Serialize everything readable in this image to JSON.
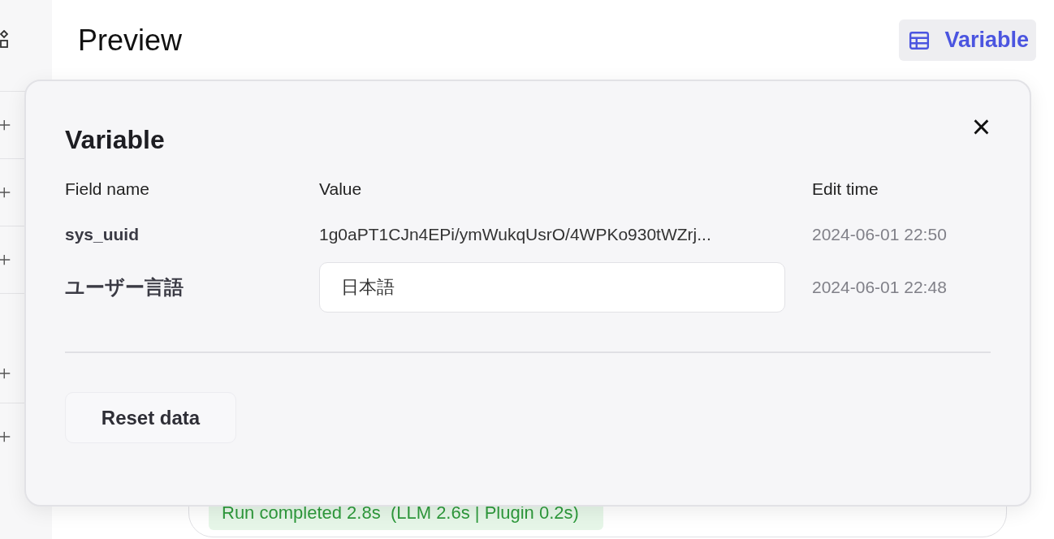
{
  "header": {
    "title": "Preview",
    "variable_button": "Variable"
  },
  "sidebar": {
    "items": [
      {
        "kind": "add"
      },
      {
        "kind": "add"
      },
      {
        "kind": "add"
      },
      {
        "kind": "add"
      },
      {
        "kind": "add"
      }
    ]
  },
  "run_status": "Run completed 2.8s  (LLM 2.6s | Plugin 0.2s)",
  "dialog": {
    "title": "Variable",
    "close": "×",
    "columns": [
      "Field name",
      "Value",
      "Edit time"
    ],
    "rows": [
      {
        "kind": "text",
        "name": "sys_uuid",
        "value": "1g0aPT1CJn4EPi/ymWukqUsrO/4WPKo930tWZrj...",
        "time": "2024-06-01 22:50"
      },
      {
        "kind": "input",
        "name": "ユーザー言語",
        "value": "日本語",
        "time": "2024-06-01 22:48"
      }
    ],
    "reset_button": "Reset data"
  }
}
